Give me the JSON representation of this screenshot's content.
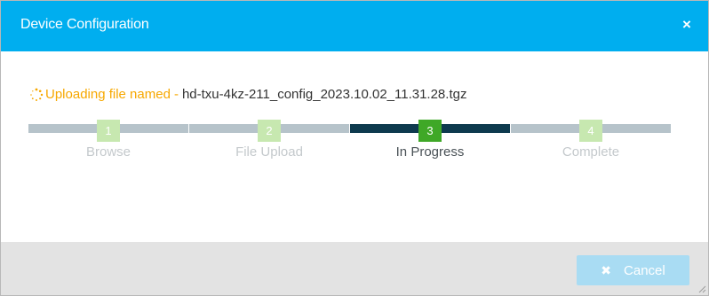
{
  "dialog": {
    "title": "Device Configuration",
    "close_icon": "×"
  },
  "status": {
    "icon": "spinner-icon",
    "label": "Uploading file named",
    "separator": "-",
    "filename": "hd-txu-4kz-211_config_2023.10.02_11.31.28.tgz"
  },
  "steps": [
    {
      "number": "1",
      "label": "Browse",
      "state": "inactive"
    },
    {
      "number": "2",
      "label": "File Upload",
      "state": "inactive"
    },
    {
      "number": "3",
      "label": "In Progress",
      "state": "active"
    },
    {
      "number": "4",
      "label": "Complete",
      "state": "inactive"
    }
  ],
  "footer": {
    "cancel_icon": "✖",
    "cancel_label": "Cancel",
    "cancel_enabled": false
  },
  "colors": {
    "header": "#00aeef",
    "status_text": "#f7a800",
    "active_bar": "#0e3a4e",
    "inactive_bar": "#b6c3ca",
    "active_badge": "#3fa827",
    "inactive_badge": "#c7e8b0",
    "cancel_button": "#a9dcf3"
  }
}
